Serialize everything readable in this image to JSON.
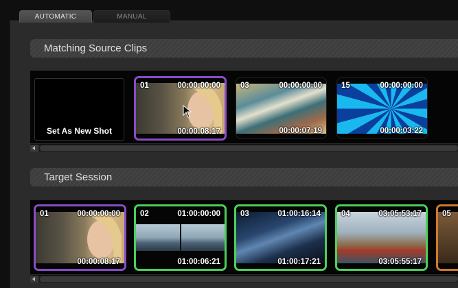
{
  "tabs": [
    {
      "label": "AUTOMATIC",
      "active": true
    },
    {
      "label": "MANUAL",
      "active": false
    }
  ],
  "matching": {
    "title": "Matching Source Clips",
    "new_shot_label": "Set As New Shot",
    "clips": [
      {
        "num": "01",
        "tc_in": "00:00:00:00",
        "duration": "00:00:08:17",
        "border": "#8a4cc8"
      },
      {
        "num": "03",
        "tc_in": "00:00:00:00",
        "duration": "00:00:07:19",
        "border": "none"
      },
      {
        "num": "15",
        "tc_in": "00:00:00:00",
        "duration": "00:00:03:22",
        "border": "none"
      }
    ]
  },
  "target": {
    "title": "Target Session",
    "clips": [
      {
        "num": "01",
        "tc_in": "00:00:00:00",
        "duration": "00:00:08:17",
        "border": "#8a4cc8"
      },
      {
        "num": "02",
        "tc_in": "01:00:00:00",
        "duration": "01:00:06:21",
        "border": "#4bd05a"
      },
      {
        "num": "03",
        "tc_in": "01:00:16:14",
        "duration": "01:00:17:21",
        "border": "#4bd05a"
      },
      {
        "num": "04",
        "tc_in": "03:05:53:17",
        "duration": "03:05:55:17",
        "border": "#4bd05a"
      },
      {
        "num": "05",
        "tc_in": "",
        "duration": "",
        "border": "#d17a2a"
      }
    ]
  }
}
